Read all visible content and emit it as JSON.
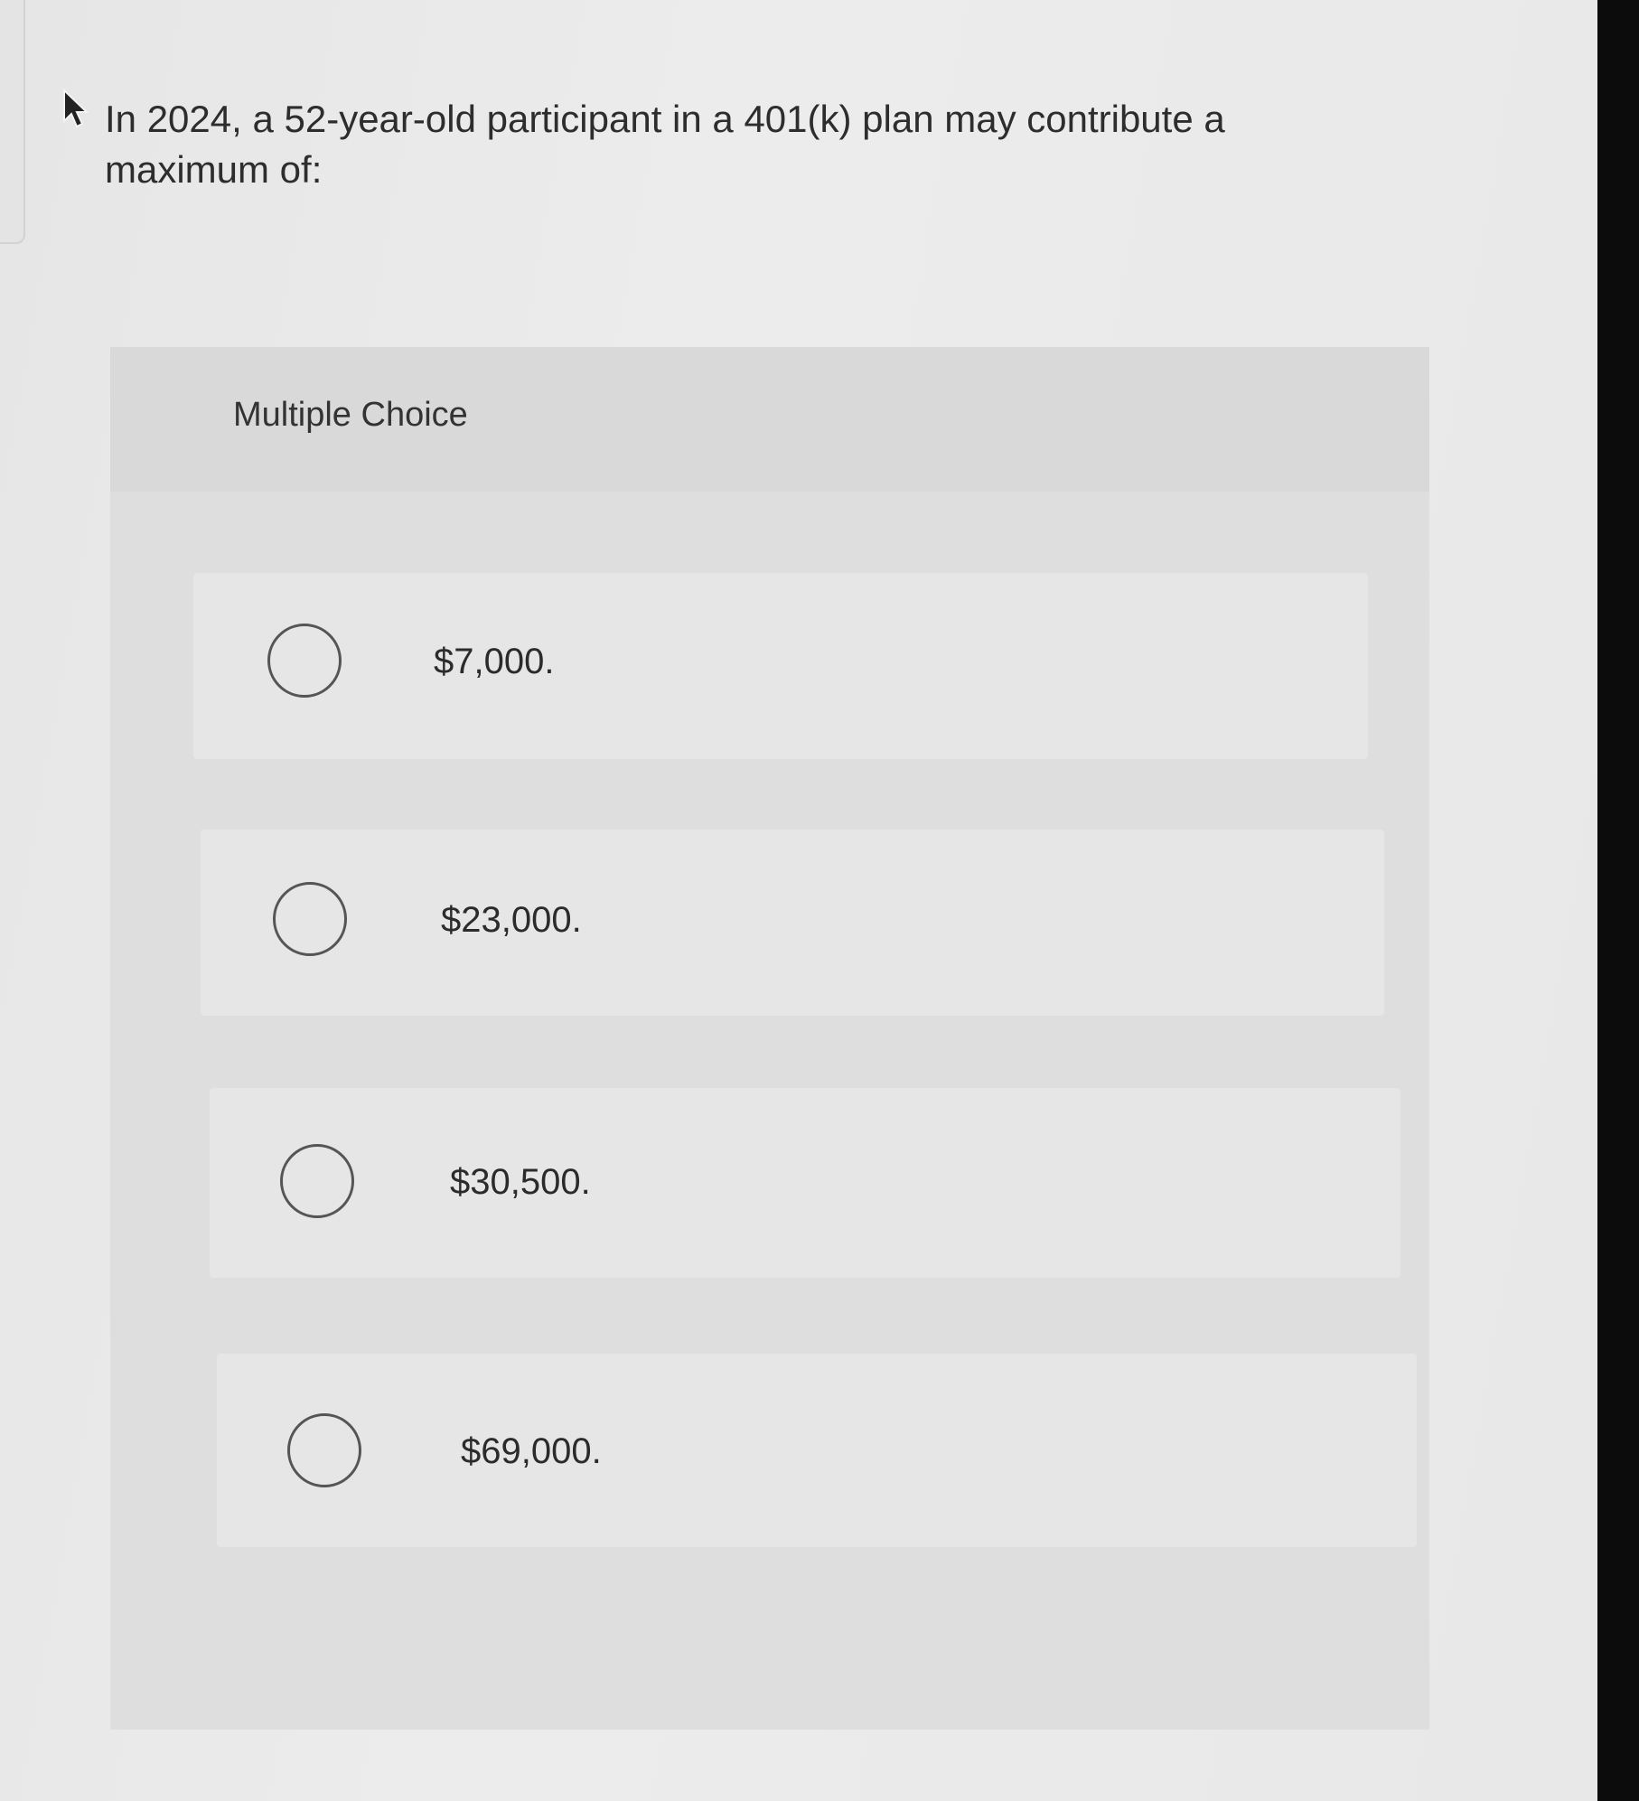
{
  "question": {
    "text": "In 2024, a 52-year-old participant in a 401(k) plan may contribute a maximum of:"
  },
  "multiple_choice": {
    "label": "Multiple Choice",
    "options": [
      {
        "label": "$7,000.",
        "selected": false
      },
      {
        "label": "$23,000.",
        "selected": false
      },
      {
        "label": "$30,500.",
        "selected": false
      },
      {
        "label": "$69,000.",
        "selected": false
      }
    ]
  },
  "colors": {
    "background": "#e9e9e9",
    "panel": "#dedede",
    "option_row": "#e6e6e6",
    "text": "#2d2d2d",
    "bezel": "#0c0c0c"
  }
}
